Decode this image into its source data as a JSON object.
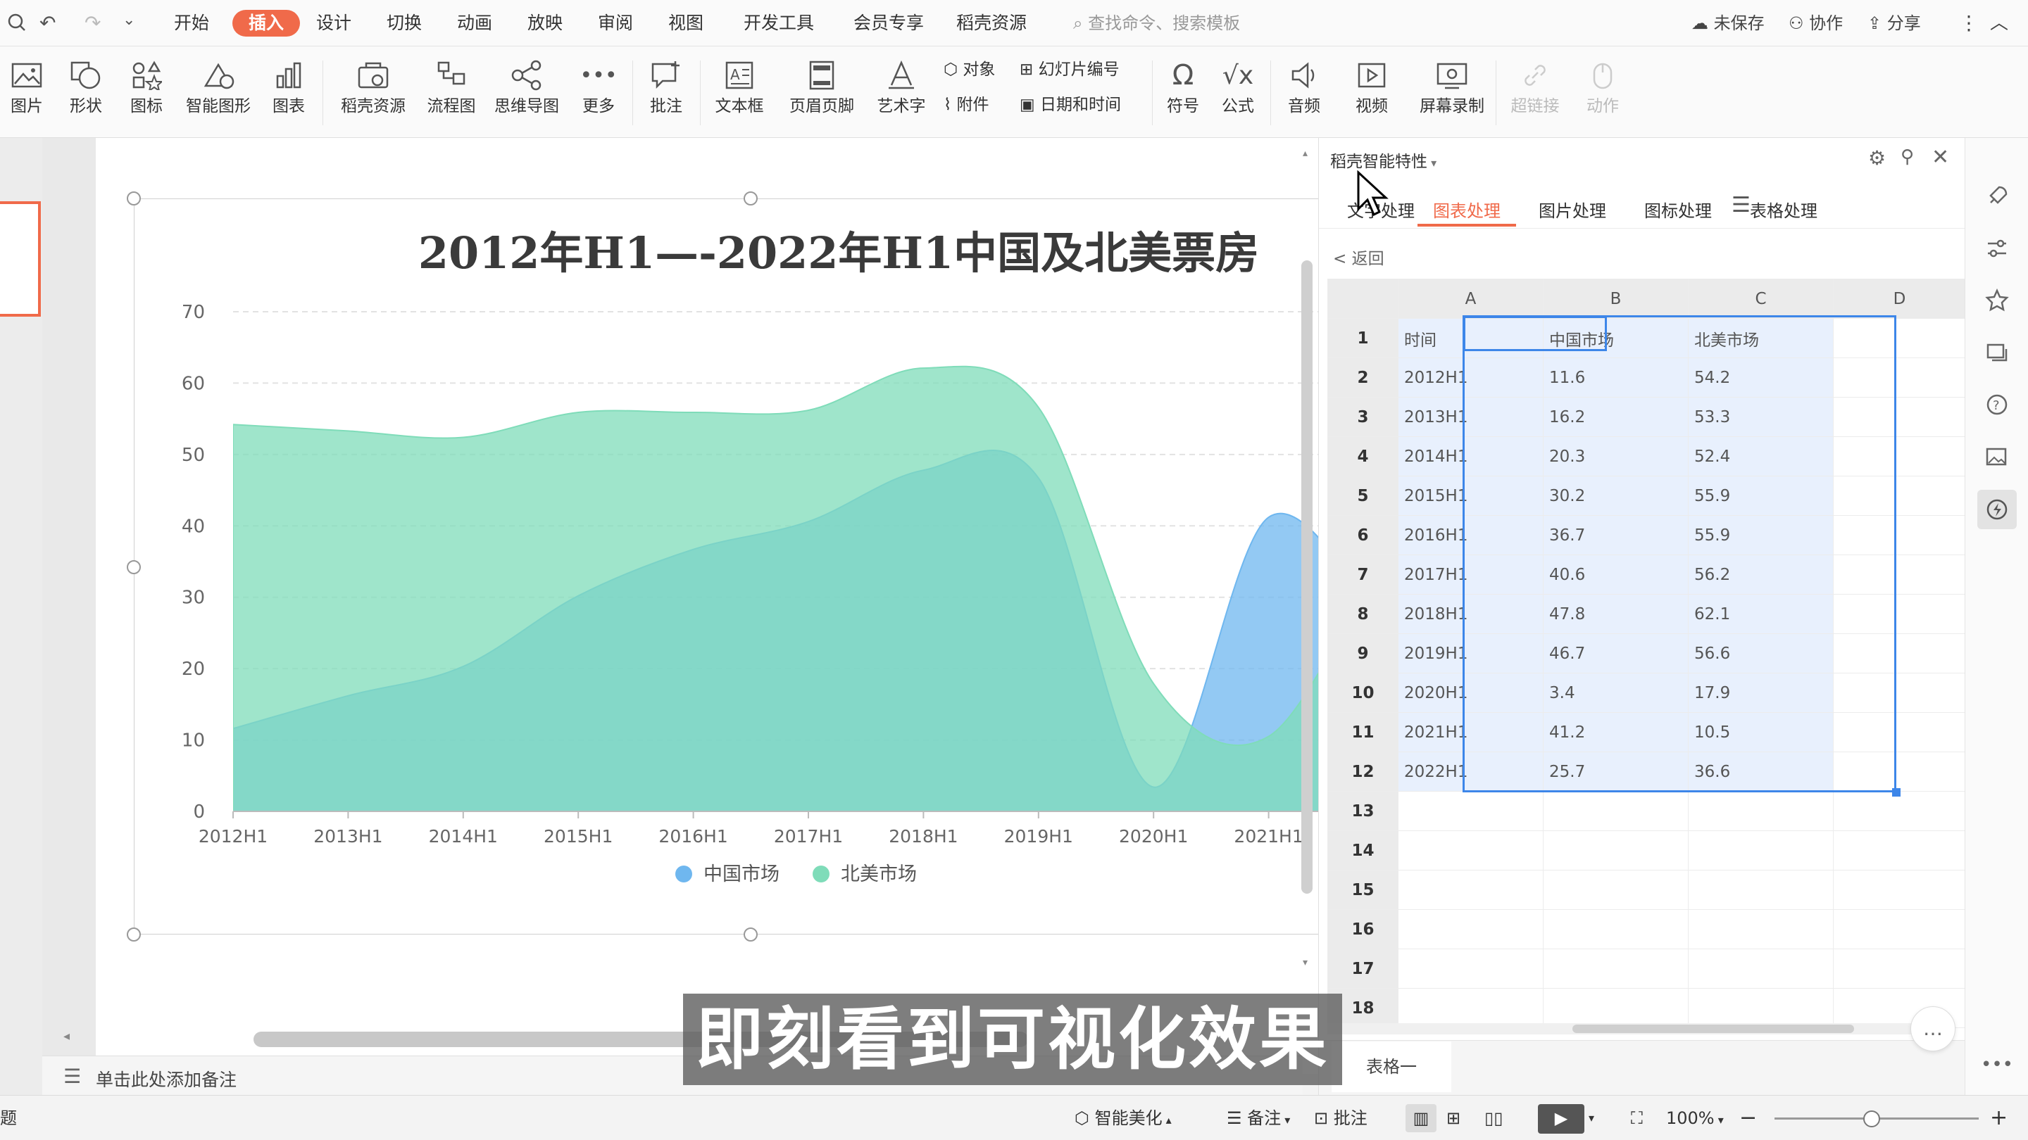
{
  "quick": {
    "undo": "↶",
    "redo": "↷",
    "more": "⌄"
  },
  "menu": {
    "tabs": [
      "开始",
      "插入",
      "设计",
      "切换",
      "动画",
      "放映",
      "审阅",
      "视图",
      "开发工具",
      "会员专享",
      "稻壳资源"
    ],
    "active": "插入",
    "search_placeholder": "查找命令、搜索模板",
    "unsaved": "未保存",
    "collab": "协作",
    "share": "分享"
  },
  "ribbon": {
    "picture": "图片",
    "shape": "形状",
    "icon": "图标",
    "smart": "智能图形",
    "chart": "图表",
    "docer": "稻壳资源",
    "flow": "流程图",
    "mind": "思维导图",
    "more": "更多",
    "comment": "批注",
    "textbox": "文本框",
    "header": "页眉页脚",
    "art": "艺术字",
    "object": "对象",
    "slidenum": "幻灯片编号",
    "attach": "附件",
    "datetime": "日期和时间",
    "symbol": "符号",
    "formula": "公式",
    "audio": "音频",
    "video": "视频",
    "record": "屏幕录制",
    "link": "超链接",
    "action": "动作"
  },
  "panel": {
    "title": "稻壳智能特性",
    "tabs": [
      "文字处理",
      "图表处理",
      "图片处理",
      "图标处理",
      "表格处理"
    ],
    "active_tab": "图表处理",
    "back": "返回",
    "sheet_tab": "表格一"
  },
  "sheet": {
    "cols": [
      "A",
      "B",
      "C",
      "D"
    ],
    "header": [
      "时间",
      "中国市场",
      "北美市场"
    ],
    "rows": [
      [
        "2012H1",
        "11.6",
        "54.2"
      ],
      [
        "2013H1",
        "16.2",
        "53.3"
      ],
      [
        "2014H1",
        "20.3",
        "52.4"
      ],
      [
        "2015H1",
        "30.2",
        "55.9"
      ],
      [
        "2016H1",
        "36.7",
        "55.9"
      ],
      [
        "2017H1",
        "40.6",
        "56.2"
      ],
      [
        "2018H1",
        "47.8",
        "62.1"
      ],
      [
        "2019H1",
        "46.7",
        "56.6"
      ],
      [
        "2020H1",
        "3.4",
        "17.9"
      ],
      [
        "2021H1",
        "41.2",
        "10.5"
      ],
      [
        "2022H1",
        "25.7",
        "36.6"
      ]
    ],
    "row_numbers": [
      "1",
      "2",
      "3",
      "4",
      "5",
      "6",
      "7",
      "8",
      "9",
      "10",
      "11",
      "12",
      "13",
      "14",
      "15",
      "16",
      "17",
      "18"
    ]
  },
  "notes": {
    "placeholder": "单击此处添加备注"
  },
  "status": {
    "left": "题",
    "beautify": "智能美化",
    "notes": "备注",
    "comment": "批注",
    "zoom": "100%"
  },
  "subtitle": "即刻看到可视化效果",
  "colors": {
    "accent": "#f06a4a",
    "china": "#6fb7ef",
    "na": "#7fdcb9"
  },
  "chart_data": {
    "type": "area",
    "title": "2012年H1—-2022年H1中国及北美票房",
    "categories": [
      "2012H1",
      "2013H1",
      "2014H1",
      "2015H1",
      "2016H1",
      "2017H1",
      "2018H1",
      "2019H1",
      "2020H1",
      "2021H1",
      "2022H1"
    ],
    "series": [
      {
        "name": "中国市场",
        "values": [
          11.6,
          16.2,
          20.3,
          30.2,
          36.7,
          40.6,
          47.8,
          46.7,
          3.4,
          41.2,
          25.7
        ]
      },
      {
        "name": "北美市场",
        "values": [
          54.2,
          53.3,
          52.4,
          55.9,
          55.9,
          56.2,
          62.1,
          56.6,
          17.9,
          10.5,
          36.6
        ]
      }
    ],
    "yticks": [
      "0",
      "10",
      "20",
      "30",
      "40",
      "50",
      "60",
      "70"
    ],
    "ylim": [
      0,
      70
    ],
    "grid": true,
    "legend": "bottom",
    "smooth": true
  }
}
